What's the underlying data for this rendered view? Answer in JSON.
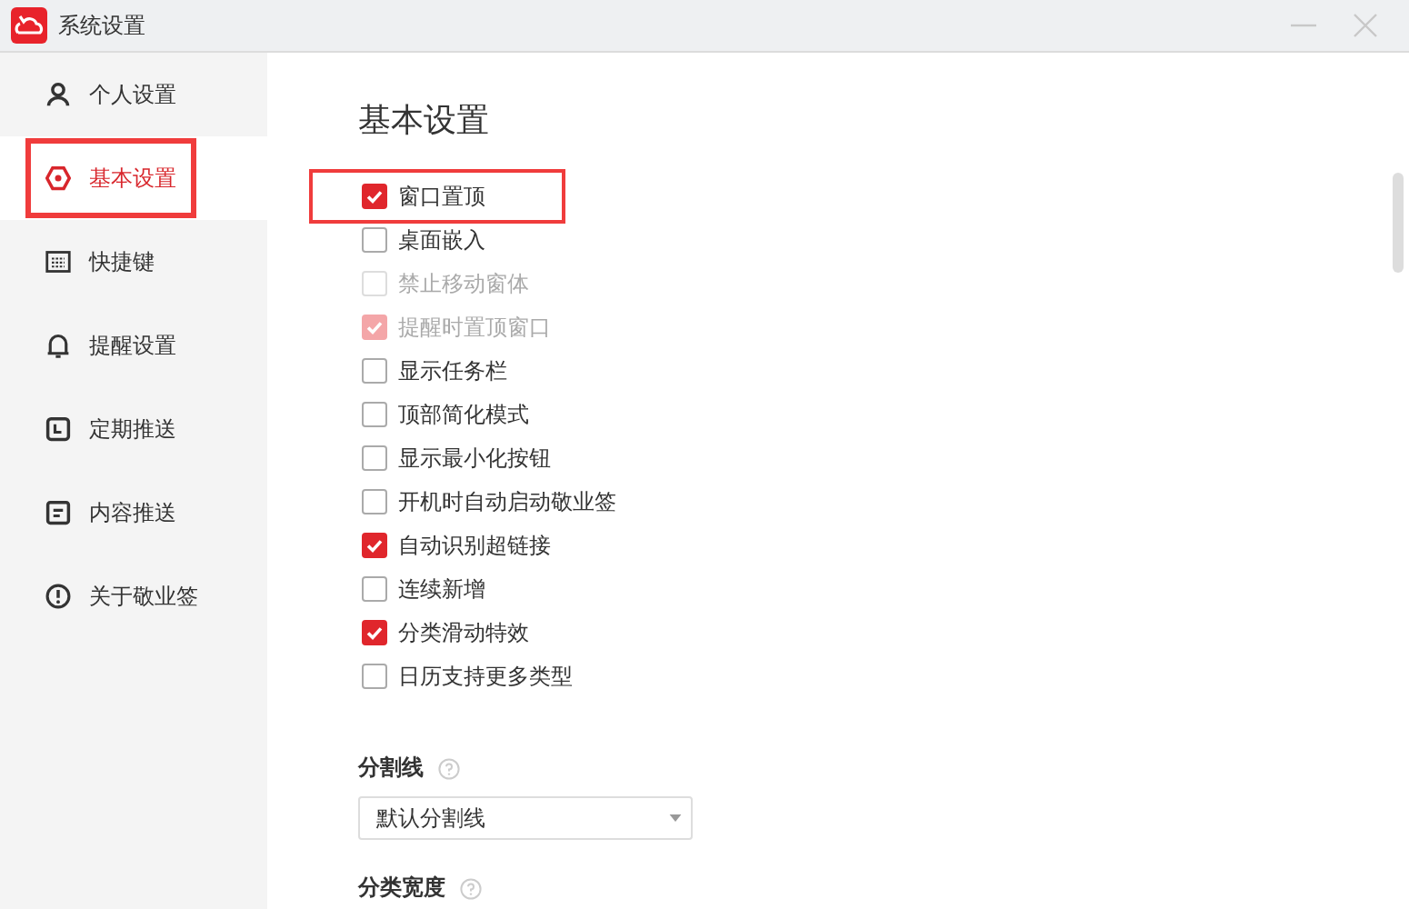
{
  "window": {
    "title": "系统设置"
  },
  "sidebar": {
    "items": [
      {
        "label": "个人设置",
        "selected": false,
        "highlighted": false
      },
      {
        "label": "基本设置",
        "selected": true,
        "highlighted": true
      },
      {
        "label": "快捷键",
        "selected": false,
        "highlighted": false
      },
      {
        "label": "提醒设置",
        "selected": false,
        "highlighted": false
      },
      {
        "label": "定期推送",
        "selected": false,
        "highlighted": false
      },
      {
        "label": "内容推送",
        "selected": false,
        "highlighted": false
      },
      {
        "label": "关于敬业签",
        "selected": false,
        "highlighted": false
      }
    ]
  },
  "content": {
    "heading": "基本设置",
    "options": [
      {
        "label": "窗口置顶",
        "checked": true,
        "disabled": false,
        "highlighted": true
      },
      {
        "label": "桌面嵌入",
        "checked": false,
        "disabled": false,
        "highlighted": false
      },
      {
        "label": "禁止移动窗体",
        "checked": false,
        "disabled": true,
        "highlighted": false
      },
      {
        "label": "提醒时置顶窗口",
        "checked": true,
        "disabled": true,
        "highlighted": false
      },
      {
        "label": "显示任务栏",
        "checked": false,
        "disabled": false,
        "highlighted": false
      },
      {
        "label": "顶部简化模式",
        "checked": false,
        "disabled": false,
        "highlighted": false
      },
      {
        "label": "显示最小化按钮",
        "checked": false,
        "disabled": false,
        "highlighted": false
      },
      {
        "label": "开机时自动启动敬业签",
        "checked": false,
        "disabled": false,
        "highlighted": false
      },
      {
        "label": "自动识别超链接",
        "checked": true,
        "disabled": false,
        "highlighted": false
      },
      {
        "label": "连续新增",
        "checked": false,
        "disabled": false,
        "highlighted": false
      },
      {
        "label": "分类滑动特效",
        "checked": true,
        "disabled": false,
        "highlighted": false
      },
      {
        "label": "日历支持更多类型",
        "checked": false,
        "disabled": false,
        "highlighted": false
      }
    ],
    "divider_setting": {
      "label": "分割线",
      "value": "默认分割线"
    },
    "width_setting": {
      "label": "分类宽度"
    }
  }
}
